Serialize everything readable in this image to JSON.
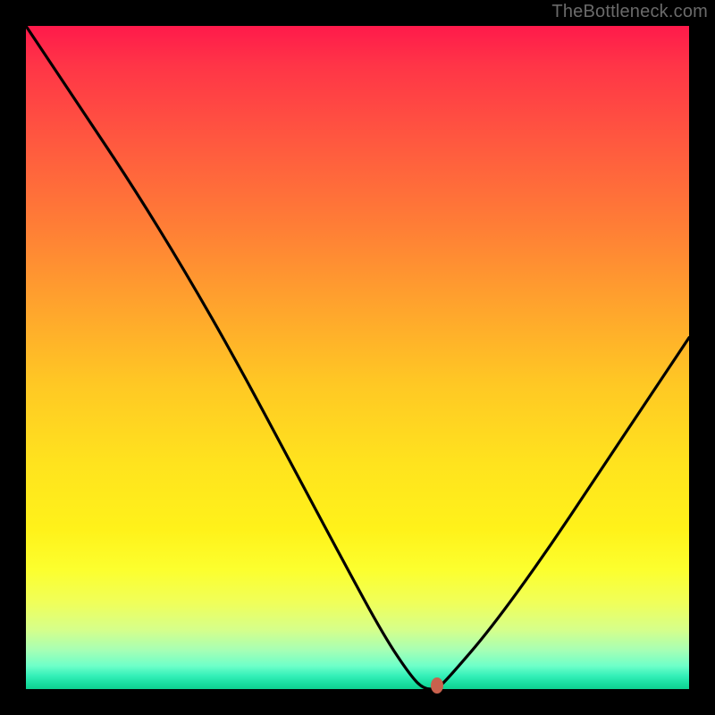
{
  "watermark": "TheBottleneck.com",
  "chart_data": {
    "type": "line",
    "title": "",
    "xlabel": "",
    "ylabel": "",
    "xlim": [
      0,
      100
    ],
    "ylim": [
      0,
      100
    ],
    "grid": false,
    "background": "rainbow-gradient-red-to-green-vertical",
    "series": [
      {
        "name": "bottleneck-curve",
        "x": [
          0,
          8,
          16,
          24,
          32,
          40,
          48,
          54,
          58,
          60,
          62,
          64,
          70,
          78,
          86,
          94,
          100
        ],
        "values": [
          100,
          88,
          76,
          63,
          49,
          34,
          19,
          8,
          2,
          0,
          0,
          2,
          9,
          20,
          32,
          44,
          53
        ]
      }
    ],
    "marker": {
      "x": 62,
      "y": 0,
      "color": "#c9614d"
    },
    "flat_minimum_range_x": [
      60,
      62
    ]
  }
}
